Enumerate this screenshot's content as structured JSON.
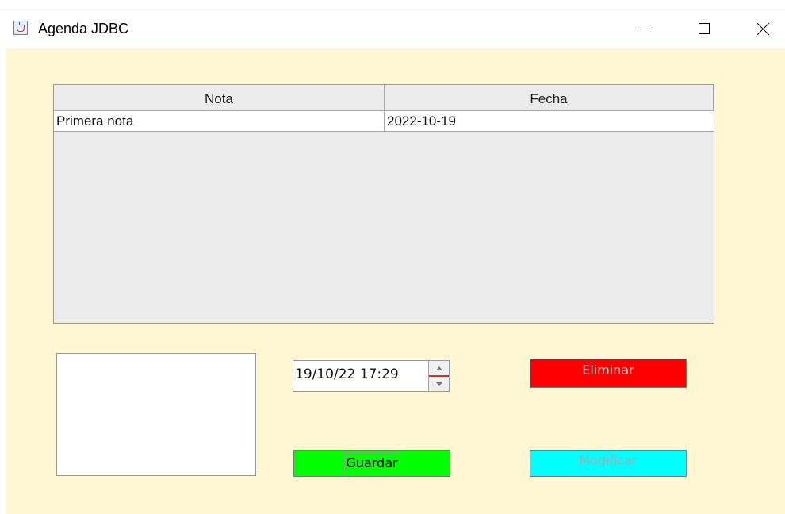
{
  "window": {
    "title": "Agenda JDBC",
    "icon": "java-coffee-icon",
    "controls": [
      "minimize-icon",
      "maximize-icon",
      "close-icon"
    ]
  },
  "table": {
    "columns": [
      "Nota",
      "Fecha"
    ],
    "rows": [
      [
        "Primera nota",
        "2022-10-19"
      ]
    ]
  },
  "form": {
    "note_text": "",
    "datetime_value": "19/10/22 17:29"
  },
  "buttons": {
    "guardar": "Guardar",
    "eliminar": "Eliminar",
    "modificar": "Modificar"
  },
  "colors": {
    "panel_background": "#fef7d1",
    "guardar": "#00ff00",
    "eliminar": "#ff0000",
    "modificar": "#00ffff"
  }
}
